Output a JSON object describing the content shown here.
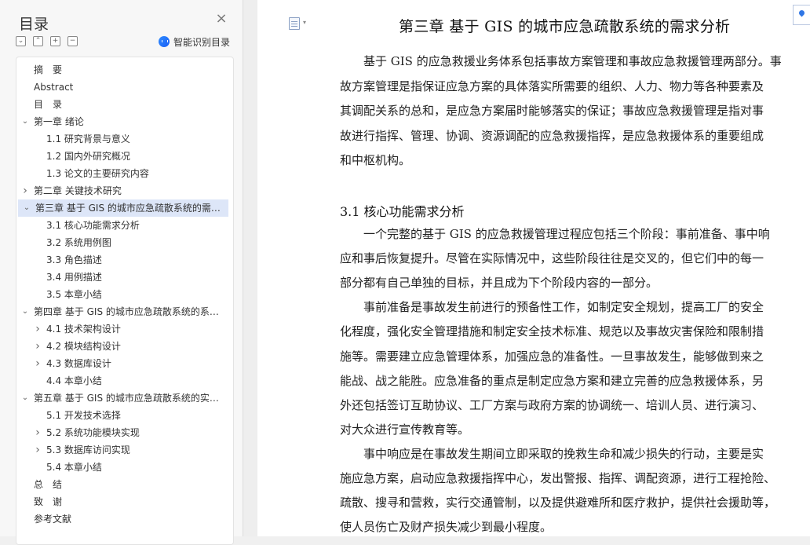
{
  "outline": {
    "title": "目录",
    "close_icon": "close-icon",
    "tools": [
      "collapse-all-icon",
      "expand-all-icon",
      "add-level-icon",
      "remove-level-icon"
    ],
    "ai_button_label": "智能识别目录",
    "items": [
      {
        "label": "摘　要",
        "level": 0,
        "toggle": ""
      },
      {
        "label": "Abstract",
        "level": 0,
        "toggle": ""
      },
      {
        "label": "目　录",
        "level": 0,
        "toggle": ""
      },
      {
        "label": "第一章 绪论",
        "level": 0,
        "toggle": "expanded"
      },
      {
        "label": "1.1  研究背景与意义",
        "level": 1,
        "toggle": ""
      },
      {
        "label": "1.2  国内外研究概况",
        "level": 1,
        "toggle": ""
      },
      {
        "label": "1.3  论文的主要研究内容",
        "level": 1,
        "toggle": ""
      },
      {
        "label": "第二章 关键技术研究",
        "level": 0,
        "toggle": "collapsed"
      },
      {
        "label": "第三章 基于 GIS 的城市应急疏散系统的需求分析",
        "level": 0,
        "toggle": "expanded",
        "selected": true
      },
      {
        "label": "3.1  核心功能需求分析",
        "level": 1,
        "toggle": ""
      },
      {
        "label": "3.2  系统用例图",
        "level": 1,
        "toggle": ""
      },
      {
        "label": "3.3  角色描述",
        "level": 1,
        "toggle": ""
      },
      {
        "label": "3.4  用例描述",
        "level": 1,
        "toggle": ""
      },
      {
        "label": "3.5  本章小结",
        "level": 1,
        "toggle": ""
      },
      {
        "label": "第四章 基于 GIS 的城市应急疏散系统的系统设计",
        "level": 0,
        "toggle": "expanded"
      },
      {
        "label": "4.1   技术架构设计",
        "level": 1,
        "toggle": "collapsed"
      },
      {
        "label": "4.2  模块结构设计",
        "level": 1,
        "toggle": "collapsed"
      },
      {
        "label": "4.3  数据库设计",
        "level": 1,
        "toggle": "collapsed"
      },
      {
        "label": "4.4  本章小结",
        "level": 1,
        "toggle": ""
      },
      {
        "label": "第五章 基于 GIS 的城市应急疏散系统的实现与测试",
        "level": 0,
        "toggle": "expanded"
      },
      {
        "label": "5.1  开发技术选择",
        "level": 1,
        "toggle": ""
      },
      {
        "label": "5.2  系统功能模块实现",
        "level": 1,
        "toggle": "collapsed"
      },
      {
        "label": "5.3  数据库访问实现",
        "level": 1,
        "toggle": "collapsed"
      },
      {
        "label": "5.4  本章小结",
        "level": 1,
        "toggle": ""
      },
      {
        "label": "总　结",
        "level": 0,
        "toggle": ""
      },
      {
        "label": "致　谢",
        "level": 0,
        "toggle": ""
      },
      {
        "label": "参考文献",
        "level": 0,
        "toggle": ""
      }
    ]
  },
  "document": {
    "heading": "第三章  基于 GIS 的城市应急疏散系统的需求分析",
    "section_heading": "3.1  核心功能需求分析",
    "intro_lines": [
      "基于 GIS 的应急救援业务体系包括事故方案管理和事故应急救援管理两部分。事",
      "故方案管理是指保证应急方案的具体落实所需要的组织、人力、物力等各种要素及",
      "其调配关系的总和，是应急方案届时能够落实的保证；事故应急救援管理是指对事",
      "故进行指挥、管理、协调、资源调配的应急救援指挥，是应急救援体系的重要组成",
      "和中枢机构。"
    ],
    "section_lines": [
      "一个完整的基于 GIS 的应急救援管理过程应包括三个阶段：事前准备、事中响",
      "应和事后恢复提升。尽管在实际情况中，这些阶段往往是交叉的，但它们中的每一",
      "部分都有自己单独的目标，并且成为下个阶段内容的一部分。",
      "事前准备是事故发生前进行的预备性工作，如制定安全规划，提高工厂的安全",
      "化程度，强化安全管理措施和制定安全技术标准、规范以及事故灾害保险和限制措",
      "施等。需要建立应急管理体系，加强应急的准备性。一旦事故发生，能够做到来之",
      "能战、战之能胜。应急准备的重点是制定应急方案和建立完善的应急救援体系，另",
      "外还包括签订互助协议、工厂方案与政府方案的协调统一、培训人员、进行演习、",
      "对大众进行宣传教育等。",
      "事中响应是在事故发生期间立即采取的挽救生命和减少损失的行动，主要是实",
      "施应急方案，启动应急救援指挥中心，发出警报、指挥、调配资源，进行工程抢险、",
      "疏散、搜寻和营救，实行交通管制，以及提供避难所和医疗救护，提供社会援助等，",
      "使人员伤亡及财产损失减少到最小程度。"
    ],
    "page_icon": "document-icon",
    "marker_icon": "location-marker-icon"
  }
}
